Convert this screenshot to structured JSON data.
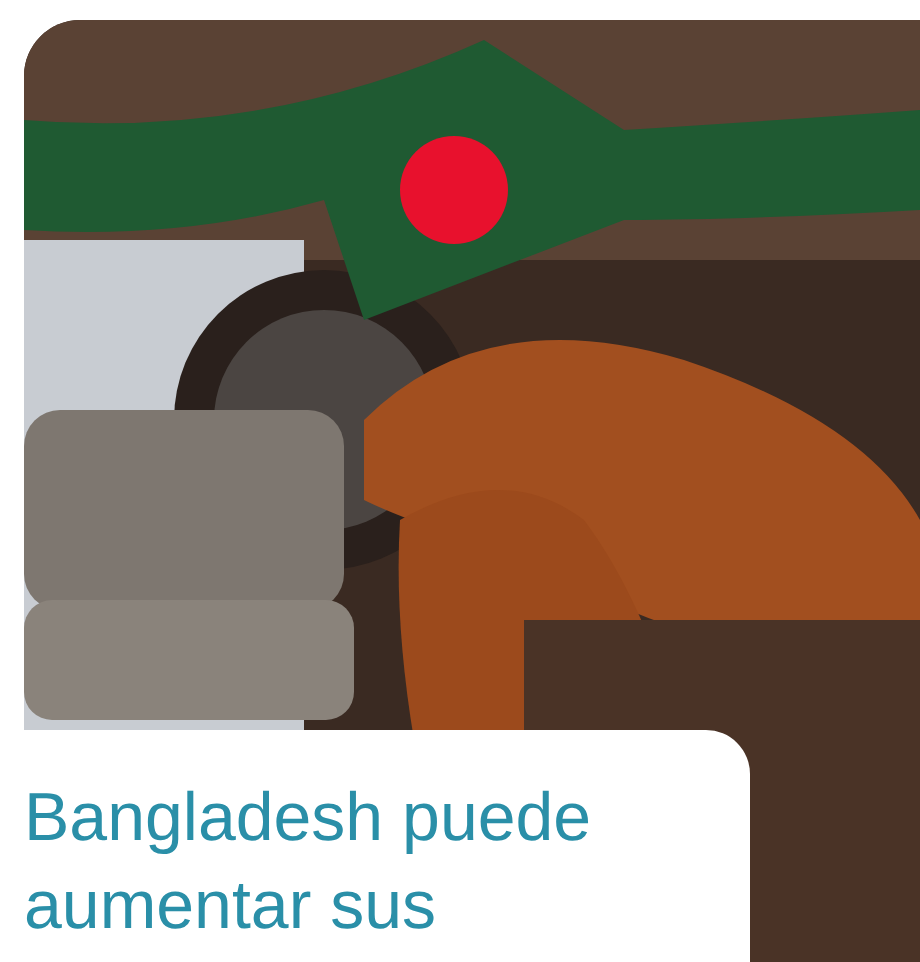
{
  "article": {
    "title": "Bangladesh puede aumentar sus"
  }
}
